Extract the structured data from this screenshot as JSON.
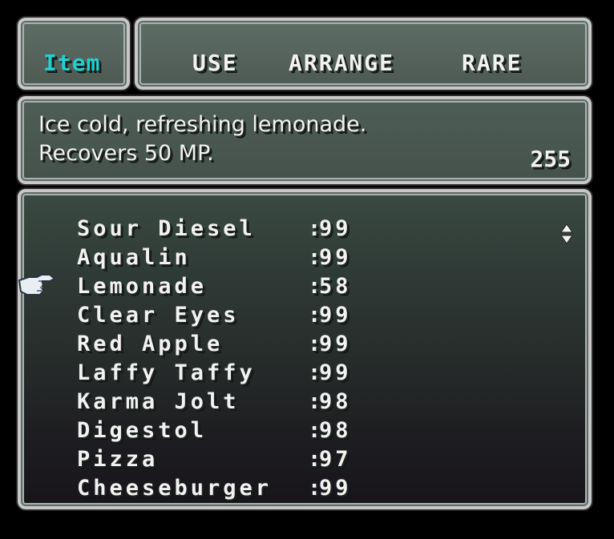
{
  "title": {
    "label": "Item"
  },
  "commands": [
    {
      "id": "use",
      "label": "USE"
    },
    {
      "id": "arrange",
      "label": "ARRANGE"
    },
    {
      "id": "rare",
      "label": "RARE"
    }
  ],
  "description": {
    "line1": "Ice cold, refreshing lemonade.",
    "line2": "Recovers 50 MP.",
    "count": "255"
  },
  "items": [
    {
      "name": "Sour Diesel",
      "qty": "99"
    },
    {
      "name": "Aqualin",
      "qty": "99"
    },
    {
      "name": "Lemonade",
      "qty": "58"
    },
    {
      "name": "Clear Eyes",
      "qty": "99"
    },
    {
      "name": "Red Apple",
      "qty": "99"
    },
    {
      "name": "Laffy Taffy",
      "qty": "99"
    },
    {
      "name": "Karma Jolt",
      "qty": "98"
    },
    {
      "name": "Digestol",
      "qty": "98"
    },
    {
      "name": "Pizza",
      "qty": "97"
    },
    {
      "name": "Cheeseburger",
      "qty": "99"
    }
  ],
  "selected_index": 2,
  "colors": {
    "title_accent": "#22d0d0",
    "text": "#f2f2f2"
  },
  "icons": {
    "cursor": "pointing-hand-icon",
    "scroll": "scroll-arrows-icon"
  }
}
